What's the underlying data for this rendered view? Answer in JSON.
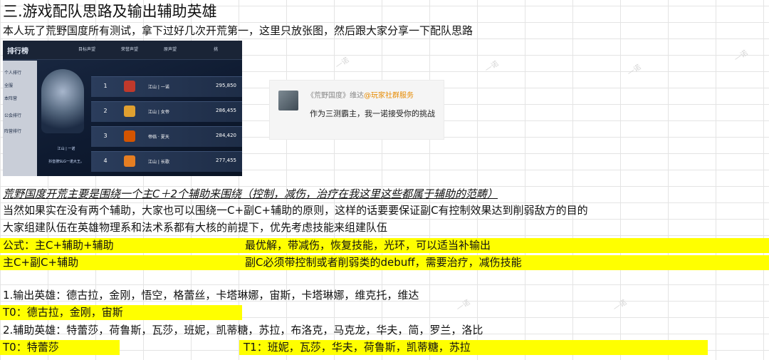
{
  "title": "三.游戏配队思路及输出辅助英雄",
  "intro": "本人玩了荒野国度所有测试，拿下过好几次开荒第一，这里只放张图，然后跟大家分享一下配队思路",
  "screenshot": {
    "header": "排行榜",
    "tabs": [
      "目标声望",
      "荣誉声望",
      "原声望",
      "挑"
    ],
    "side_items": [
      "个人排行",
      "全服",
      "本阵营",
      "公会排行",
      "阵营排行"
    ],
    "guild_label": "江山 | 一诺",
    "guild_sub": "抖音搜SLG一诺大王。",
    "rows": [
      {
        "rank": "1",
        "name": "江山 | 一诺",
        "score": "295,850",
        "badge_color": "#c0392b"
      },
      {
        "rank": "2",
        "name": "江山 | 女帝",
        "score": "286,455",
        "badge_color": "#e0a030"
      },
      {
        "rank": "3",
        "name": "帝临 · 夏天",
        "score": "284,420",
        "badge_color": "#d35400"
      },
      {
        "rank": "4",
        "name": "江山 | 长歌",
        "score": "277,455",
        "badge_color": "#e67e22"
      }
    ]
  },
  "social_card": {
    "prefix": "《荒野国度》维达",
    "account": "@玩家社群服务",
    "message": "作为三测霸主，我一诺接受你的挑战"
  },
  "watermark": "一诺",
  "core_line": "荒野国度开荒主要是围绕一个主C＋2个辅助来围绕（控制，减伤，治疗在我这里这些都属于辅助的范畴）",
  "line2": "当然如果实在没有两个辅助，大家也可以围绕一C+副C+辅助的原则，这样的话要要保证副C有控制效果达到削弱敌方的目的",
  "line3": "大家组建队伍在英雄物理系和法术系都有大核的前提下，优先考虑技能来组建队伍",
  "formula1": {
    "left": "公式：主C+辅助+辅助",
    "right": "最优解，带减伤，恢复技能，光环，可以适当补输出"
  },
  "formula2": {
    "left": "主C+副C+辅助",
    "right": "副C必须带控制或者削弱类的debuff，需要治疗，减伤技能"
  },
  "output_heroes": "1.输出英雄：德古拉，金刚，悟空，格蕾丝，卡塔琳娜，宙斯，卡塔琳娜，维克托，维达",
  "t0_output": "T0：德古拉，金刚，宙斯",
  "support_heroes": "2.辅助英雄：特蕾莎，荷鲁斯，瓦莎，班妮，凯蒂糖，苏拉，布洛克，马克龙，华夫，简，罗兰，洛比",
  "t0_support": "T0：特蕾莎",
  "t1_support": "T1：班妮，瓦莎，华夫，荷鲁斯，凯蒂糖，苏拉",
  "colors": {
    "highlight": "#ffff00",
    "grid": "#e4e4e4"
  }
}
